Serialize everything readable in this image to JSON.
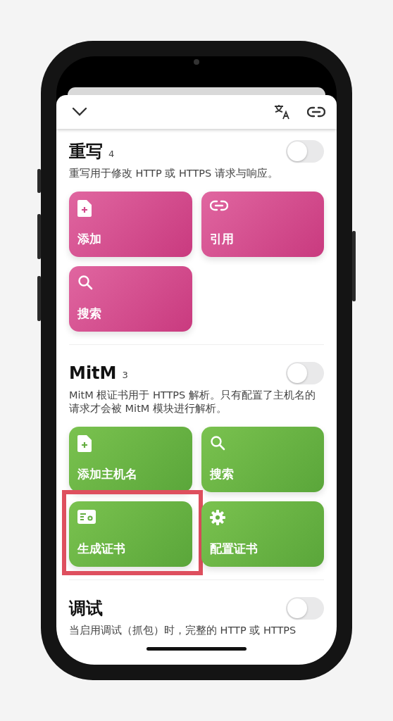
{
  "sections": [
    {
      "title": "重写",
      "count": "4",
      "on": false,
      "description": "重写用于修改 HTTP 或 HTTPS 请求与响应。",
      "tiles": [
        {
          "label": "添加",
          "highlighted": false
        },
        {
          "label": "引用",
          "highlighted": false
        },
        {
          "label": "搜索",
          "highlighted": false
        }
      ]
    },
    {
      "title": "MitM",
      "count": "3",
      "on": false,
      "description": "MitM 根证书用于 HTTPS 解析。只有配置了主机名的请求才会被 MitM 模块进行解析。",
      "tiles": [
        {
          "label": "添加主机名",
          "highlighted": false
        },
        {
          "label": "搜索",
          "highlighted": false
        },
        {
          "label": "生成证书",
          "highlighted": true
        },
        {
          "label": "配置证书",
          "highlighted": false
        }
      ]
    },
    {
      "title": "调试",
      "on": false,
      "description": "当启用调试（抓包）时，完整的 HTTP 或 HTTPS"
    }
  ]
}
